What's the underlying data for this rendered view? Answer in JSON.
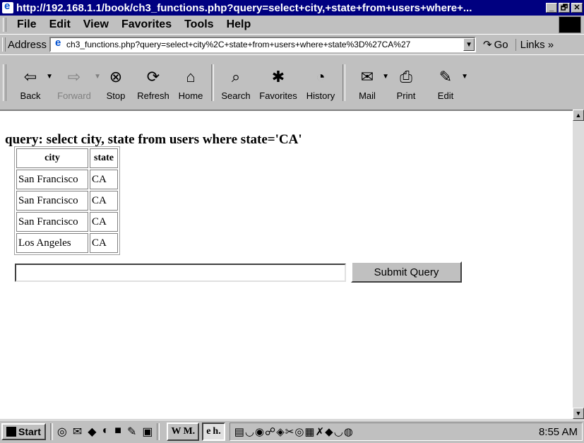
{
  "window": {
    "title": "http://192.168.1.1/book/ch3_functions.php?query=select+city,+state+from+users+where+...",
    "minimize": "_",
    "maximize": "🗗",
    "close": "✕"
  },
  "menu": {
    "items": [
      {
        "label": "File"
      },
      {
        "label": "Edit"
      },
      {
        "label": "View"
      },
      {
        "label": "Favorites"
      },
      {
        "label": "Tools"
      },
      {
        "label": "Help"
      }
    ]
  },
  "address": {
    "label": "Address",
    "value": "ch3_functions.php?query=select+city%2C+state+from+users+where+state%3D%27CA%27",
    "go_label": "Go",
    "links_label": "Links »"
  },
  "toolbar": {
    "buttons": [
      {
        "label": "Back",
        "icon": "back-arrow-icon",
        "glyph": "⇦"
      },
      {
        "label": "Forward",
        "icon": "forward-arrow-icon",
        "glyph": "⇨"
      },
      {
        "label": "Stop",
        "icon": "stop-icon",
        "glyph": "⊗"
      },
      {
        "label": "Refresh",
        "icon": "refresh-icon",
        "glyph": "⟳"
      },
      {
        "label": "Home",
        "icon": "home-icon",
        "glyph": "⌂"
      },
      {
        "label": "Search",
        "icon": "search-icon",
        "glyph": "⌕"
      },
      {
        "label": "Favorites",
        "icon": "favorites-icon",
        "glyph": "✱"
      },
      {
        "label": "History",
        "icon": "history-icon",
        "glyph": "◔"
      },
      {
        "label": "Mail",
        "icon": "mail-icon",
        "glyph": "✉"
      },
      {
        "label": "Print",
        "icon": "print-icon",
        "glyph": "⎙"
      },
      {
        "label": "Edit",
        "icon": "edit-icon",
        "glyph": "✎"
      }
    ]
  },
  "page": {
    "query_text": "query: select city, state from users where state='CA'",
    "table": {
      "headers": [
        "city",
        "state"
      ],
      "rows": [
        [
          "San Francisco",
          "CA"
        ],
        [
          "San Francisco",
          "CA"
        ],
        [
          "San Francisco",
          "CA"
        ],
        [
          "Los Angeles",
          "CA"
        ]
      ]
    },
    "input_value": "",
    "submit_label": "Submit Query"
  },
  "taskbar": {
    "start_label": "Start",
    "tasks": [
      {
        "label": "M.",
        "prefix": "W"
      },
      {
        "label": "h.",
        "prefix": "e"
      }
    ],
    "clock": "8:55 AM"
  }
}
